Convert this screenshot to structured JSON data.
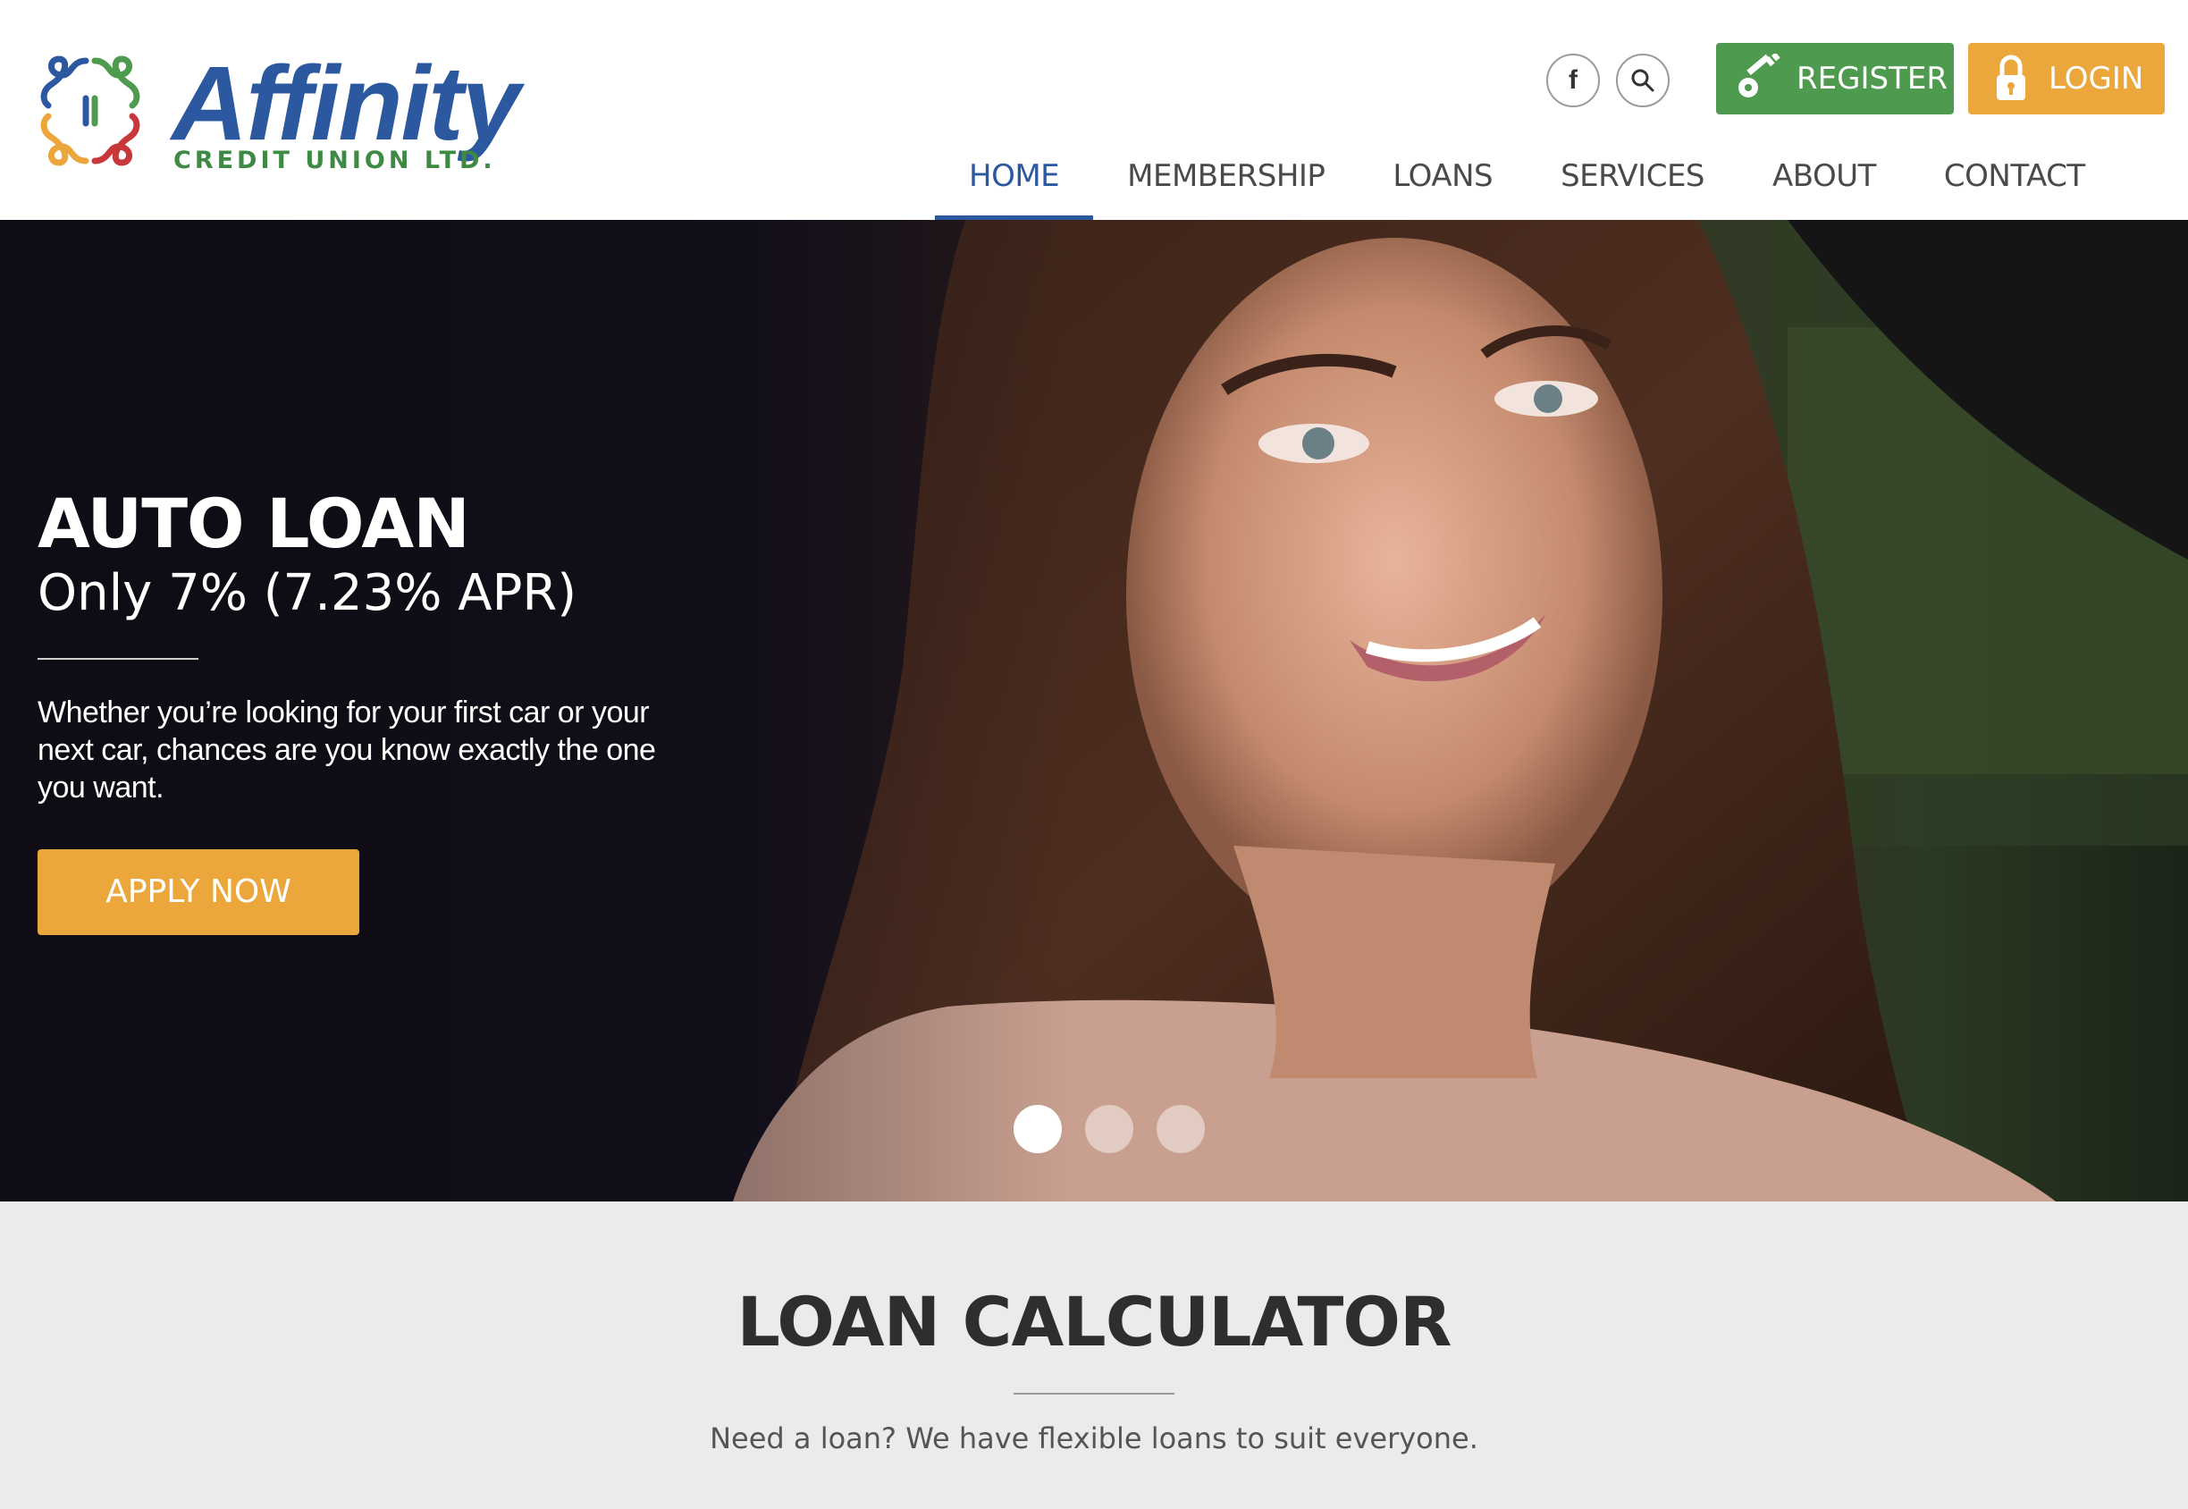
{
  "brand": {
    "name": "Affinity",
    "subtitle": "CREDIT UNION LTD.",
    "primary_color": "#2c58a0",
    "green": "#4e9a4f",
    "orange": "#eba73c"
  },
  "header": {
    "social": [
      {
        "icon": "facebook-icon",
        "glyph": "f"
      },
      {
        "icon": "search-icon"
      }
    ],
    "register_label": "REGISTER",
    "login_label": "LOGIN",
    "nav": [
      {
        "label": "HOME",
        "active": true
      },
      {
        "label": "MEMBERSHIP",
        "active": false
      },
      {
        "label": "LOANS",
        "active": false
      },
      {
        "label": "SERVICES",
        "active": false
      },
      {
        "label": "ABOUT",
        "active": false
      },
      {
        "label": "CONTACT",
        "active": false
      }
    ]
  },
  "hero": {
    "title": "AUTO LOAN",
    "subtitle": "Only 7% (7.23% APR)",
    "description": "Whether you’re looking for your first car or your next car, chances are you know exactly the one you want.",
    "cta_label": "APPLY NOW",
    "slides": 3,
    "active_slide": 1
  },
  "calculator": {
    "title": "LOAN CALCULATOR",
    "text": "Need a loan? We have flexible loans to suit everyone."
  }
}
